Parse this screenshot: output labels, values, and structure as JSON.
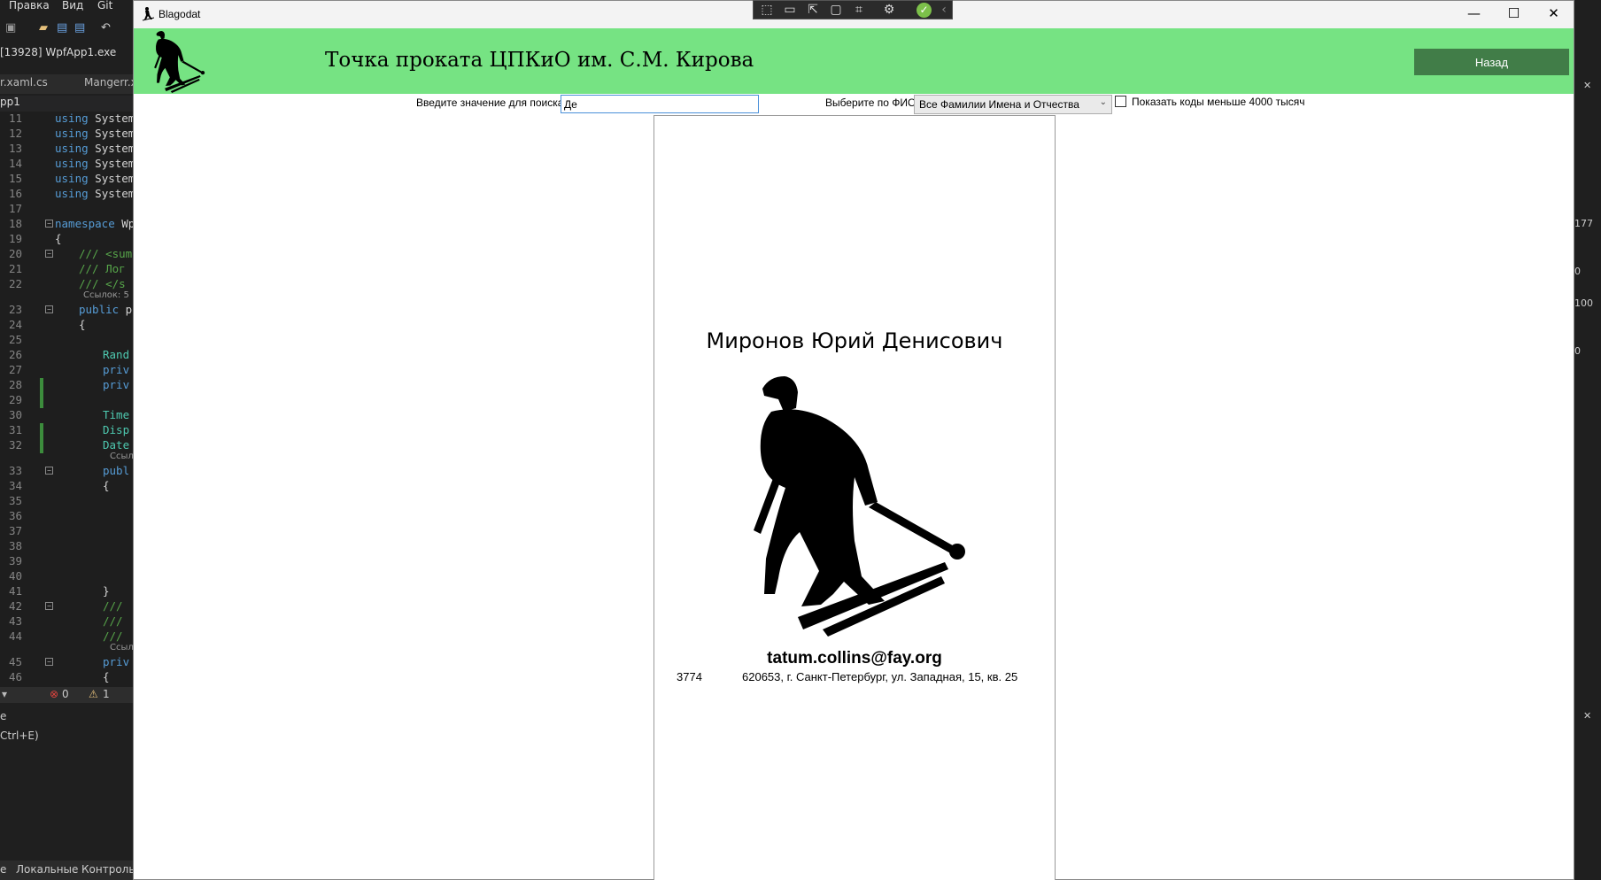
{
  "ide": {
    "menu": [
      "Правка",
      "Вид",
      "Git"
    ],
    "process": "[13928] WpfApp1.exe",
    "tabs": [
      "r.xaml.cs",
      "Mangerr.x"
    ],
    "project": "pp1",
    "code_lines": [
      {
        "n": "11",
        "code": "using System"
      },
      {
        "n": "12",
        "code": "using System"
      },
      {
        "n": "13",
        "code": "using System"
      },
      {
        "n": "14",
        "code": "using System"
      },
      {
        "n": "15",
        "code": "using System"
      },
      {
        "n": "16",
        "code": "using System"
      },
      {
        "n": "17",
        "code": ""
      },
      {
        "n": "18",
        "code": "namespace Wp"
      },
      {
        "n": "19",
        "code": "{"
      },
      {
        "n": "20",
        "code": "/// <sum"
      },
      {
        "n": "21",
        "code": "/// Лог"
      },
      {
        "n": "22",
        "code": "/// </s"
      },
      {
        "n": "23",
        "code": "public p"
      },
      {
        "n": "24",
        "code": "{"
      },
      {
        "n": "25",
        "code": ""
      },
      {
        "n": "26",
        "code": "Rand"
      },
      {
        "n": "27",
        "code": "priv"
      },
      {
        "n": "28",
        "code": "priv"
      },
      {
        "n": "29",
        "code": ""
      },
      {
        "n": "30",
        "code": "Time"
      },
      {
        "n": "31",
        "code": "Disp"
      },
      {
        "n": "32",
        "code": "Date"
      },
      {
        "n": "33",
        "code": "publ"
      },
      {
        "n": "34",
        "code": "{"
      },
      {
        "n": "35",
        "code": ""
      },
      {
        "n": "36",
        "code": ""
      },
      {
        "n": "37",
        "code": ""
      },
      {
        "n": "38",
        "code": ""
      },
      {
        "n": "39",
        "code": ""
      },
      {
        "n": "40",
        "code": ""
      },
      {
        "n": "41",
        "code": "}"
      },
      {
        "n": "42",
        "code": "///"
      },
      {
        "n": "43",
        "code": "///"
      },
      {
        "n": "44",
        "code": "///"
      },
      {
        "n": "45",
        "code": "priv"
      },
      {
        "n": "46",
        "code": "{"
      }
    ],
    "refs_label": "Ссылок: 5",
    "refs_short": "Ссыл",
    "errors": "0",
    "warnings": "1",
    "lower_hint": "Ctrl+E)",
    "bottom_tabs": [
      "е",
      "Локальные",
      "Контроль"
    ],
    "right_values": [
      "177",
      "0",
      "100",
      "0"
    ]
  },
  "window": {
    "title": "Blagodat",
    "app_title": "Точка проката ЦПКиО им. С.М. Кирова",
    "back_button": "Назад",
    "controls": {
      "minimize": "—",
      "maximize": "☐",
      "close": "✕"
    }
  },
  "filters": {
    "search_label": "Введите значение для поиска",
    "search_value": "Де",
    "fio_label": "Выберите по ФИО",
    "fio_selected": "Все Фамилии Имена и Отчества",
    "checkbox_label": "Показать коды меньше 4000 тысяч",
    "checkbox_checked": false
  },
  "clients": [
    {
      "name": "Миронов Юрий Денисович",
      "email": "tatum.collins@fay.org",
      "code": "3774",
      "address": "620653, г. Санкт-Петербург, ул. Западная, 15, кв. 25"
    }
  ],
  "colors": {
    "header_bg": "#76e383",
    "back_button_bg": "#417d48"
  },
  "icons": {
    "logo": "skier-icon",
    "client_photo": "skier-icon"
  }
}
